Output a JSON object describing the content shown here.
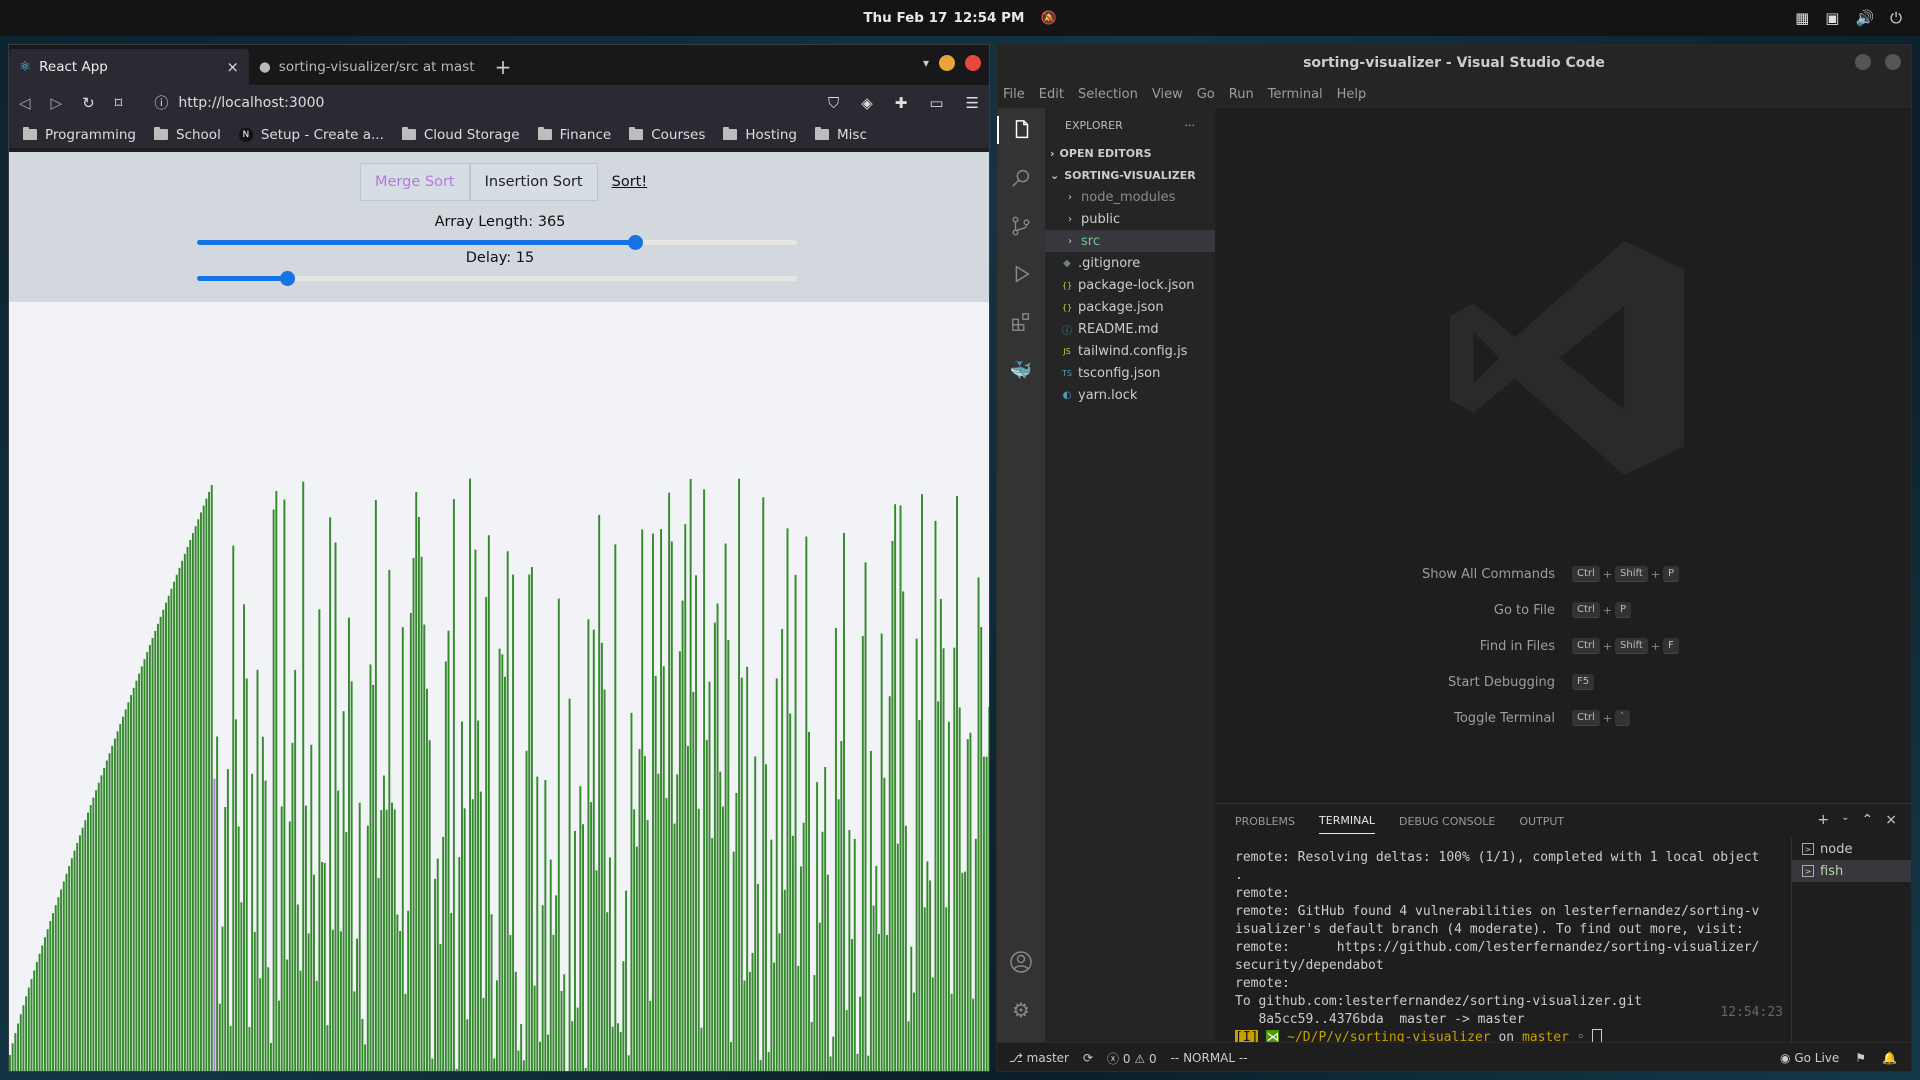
{
  "topbar": {
    "date": "Thu Feb 17",
    "time": "12:54 PM"
  },
  "browser": {
    "tabs": [
      {
        "title": "React App",
        "active": true
      },
      {
        "title": "sorting-visualizer/src at master · lesterfernandez/sorting-visualizer",
        "active": false
      }
    ],
    "url": "http://localhost:3000",
    "bookmarks": [
      "Programming",
      "School",
      "Setup - Create a...",
      "Cloud Storage",
      "Finance",
      "Courses",
      "Hosting",
      "Misc"
    ]
  },
  "app": {
    "algorithms": [
      "Merge Sort",
      "Insertion Sort"
    ],
    "selected_algorithm": "Merge Sort",
    "sort_label": "Sort!",
    "array_length_label": "Array Length: 365",
    "array_length": 365,
    "array_length_fraction": 0.73,
    "delay_label": "Delay: 15",
    "delay": 15,
    "delay_fraction": 0.15,
    "bar_color": "#36892f",
    "active_bar_color": "#b57ad9"
  },
  "vscode": {
    "title": "sorting-visualizer - Visual Studio Code",
    "menu": [
      "File",
      "Edit",
      "Selection",
      "View",
      "Go",
      "Run",
      "Terminal",
      "Help"
    ],
    "explorer_label": "EXPLORER",
    "open_editors_label": "OPEN EDITORS",
    "project_label": "SORTING-VISUALIZER",
    "files": [
      {
        "name": "node_modules",
        "icon": "chevron-right-icon",
        "folder": true,
        "dim": true
      },
      {
        "name": "public",
        "icon": "chevron-right-icon",
        "folder": true
      },
      {
        "name": "src",
        "icon": "chevron-right-icon",
        "folder": true,
        "selected": true
      },
      {
        "name": ".gitignore",
        "icon": "diamond-icon"
      },
      {
        "name": "package-lock.json",
        "icon": "braces-icon"
      },
      {
        "name": "package.json",
        "icon": "braces-icon"
      },
      {
        "name": "README.md",
        "icon": "info-icon"
      },
      {
        "name": "tailwind.config.js",
        "icon": "js-icon"
      },
      {
        "name": "tsconfig.json",
        "icon": "ts-icon"
      },
      {
        "name": "yarn.lock",
        "icon": "yarn-icon"
      }
    ],
    "shortcuts": [
      {
        "label": "Show All Commands",
        "keys": [
          "Ctrl",
          "+",
          "Shift",
          "+",
          "P"
        ]
      },
      {
        "label": "Go to File",
        "keys": [
          "Ctrl",
          "+",
          "P"
        ]
      },
      {
        "label": "Find in Files",
        "keys": [
          "Ctrl",
          "+",
          "Shift",
          "+",
          "F"
        ]
      },
      {
        "label": "Start Debugging",
        "keys": [
          "F5"
        ]
      },
      {
        "label": "Toggle Terminal",
        "keys": [
          "Ctrl",
          "+",
          "`"
        ]
      }
    ],
    "panel_tabs": [
      "PROBLEMS",
      "TERMINAL",
      "DEBUG CONSOLE",
      "OUTPUT"
    ],
    "active_panel_tab": "TERMINAL",
    "terminal_lines": [
      "remote: Resolving deltas: 100% (1/1), completed with 1 local object",
      ".",
      "remote:",
      "remote: GitHub found 4 vulnerabilities on lesterfernandez/sorting-v",
      "isualizer's default branch (4 moderate). To find out more, visit:",
      "remote:      https://github.com/lesterfernandez/sorting-visualizer/",
      "security/dependabot",
      "remote:",
      "To github.com:lesterfernandez/sorting-visualizer.git",
      "   8a5cc59..4376bda  master -> master"
    ],
    "prompt": {
      "mode": "[I]",
      "path": "~/D/P/y/sorting-visualizer",
      "on": "on",
      "branch": "master",
      "dirty": "◦"
    },
    "terminal_time": "12:54:23",
    "terminals": [
      "node",
      "fish"
    ],
    "status": {
      "branch": "master",
      "errors": "0",
      "warnings": "0",
      "mode": "-- NORMAL --",
      "go_live": "Go Live"
    }
  }
}
